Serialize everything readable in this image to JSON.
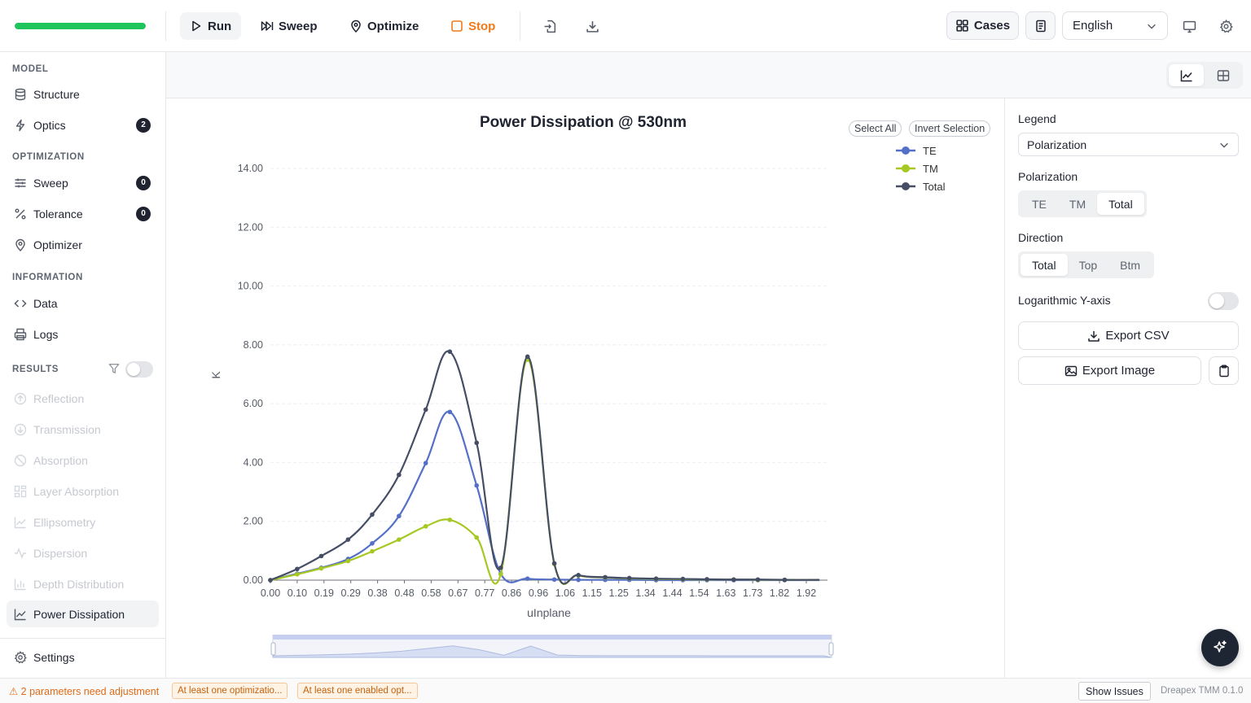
{
  "toolbar": {
    "progress": 1.0,
    "run_label": "Run",
    "sweep_label": "Sweep",
    "optimize_label": "Optimize",
    "stop_label": "Stop",
    "cases_label": "Cases",
    "language": "English"
  },
  "sidebar": {
    "model_title": "MODEL",
    "structure": "Structure",
    "optics": "Optics",
    "optics_count": "2",
    "optimization_title": "OPTIMIZATION",
    "sweep": "Sweep",
    "sweep_count": "0",
    "tolerance": "Tolerance",
    "tolerance_count": "0",
    "optimizer": "Optimizer",
    "information_title": "INFORMATION",
    "data": "Data",
    "logs": "Logs",
    "results_title": "RESULTS",
    "results": [
      "Reflection",
      "Transmission",
      "Absorption",
      "Layer Absorption",
      "Ellipsometry",
      "Dispersion",
      "Depth Distribution",
      "Power Dissipation"
    ],
    "settings": "Settings"
  },
  "chart": {
    "select_all": "Select All",
    "invert_selection": "Invert Selection"
  },
  "chart_data": {
    "type": "line",
    "title": "Power Dissipation @ 530nm",
    "xlabel": "uInplane",
    "ylabel": "K",
    "ylim": [
      0,
      14
    ],
    "yticks": [
      "0.00",
      "2.00",
      "4.00",
      "6.00",
      "8.00",
      "10.00",
      "12.00",
      "14.00"
    ],
    "xticks": [
      "0.00",
      "0.10",
      "0.19",
      "0.29",
      "0.38",
      "0.48",
      "0.58",
      "0.67",
      "0.77",
      "0.86",
      "0.96",
      "1.06",
      "1.15",
      "1.25",
      "1.34",
      "1.44",
      "1.54",
      "1.63",
      "1.73",
      "1.82",
      "1.92"
    ],
    "legend_position": "top-right",
    "grid": true,
    "series": [
      {
        "name": "TE",
        "color": "#5470c6",
        "x": [
          0.0,
          0.1,
          0.19,
          0.29,
          0.38,
          0.48,
          0.58,
          0.67,
          0.77,
          0.86,
          0.96,
          1.06,
          1.15,
          1.25,
          1.34,
          1.44,
          1.54,
          1.63,
          1.73,
          1.82,
          1.92,
          2.05
        ],
        "values": [
          0.0,
          0.22,
          0.42,
          0.72,
          1.25,
          2.18,
          3.98,
          5.72,
          3.22,
          0.22,
          0.05,
          0.02,
          0.01,
          0.01,
          0.01,
          0.0,
          0.0,
          0.0,
          0.0,
          0.0,
          0.0,
          0.0
        ]
      },
      {
        "name": "TM",
        "color": "#a6c822",
        "x": [
          0.0,
          0.1,
          0.19,
          0.29,
          0.38,
          0.48,
          0.58,
          0.67,
          0.77,
          0.86,
          0.96,
          1.06,
          1.15,
          1.25,
          1.34,
          1.44,
          1.54,
          1.63,
          1.73,
          1.82,
          1.92,
          2.05
        ],
        "values": [
          0.0,
          0.2,
          0.4,
          0.65,
          0.98,
          1.38,
          1.83,
          2.05,
          1.45,
          0.2,
          7.5,
          0.55,
          0.16,
          0.09,
          0.06,
          0.04,
          0.03,
          0.02,
          0.02,
          0.01,
          0.01,
          0.01
        ]
      },
      {
        "name": "Total",
        "color": "#464e66",
        "x": [
          0.0,
          0.1,
          0.19,
          0.29,
          0.38,
          0.48,
          0.58,
          0.67,
          0.77,
          0.86,
          0.96,
          1.06,
          1.15,
          1.25,
          1.34,
          1.44,
          1.54,
          1.63,
          1.73,
          1.82,
          1.92,
          2.05
        ],
        "values": [
          0.0,
          0.38,
          0.82,
          1.38,
          2.23,
          3.58,
          5.8,
          7.77,
          4.67,
          0.42,
          7.6,
          0.57,
          0.17,
          0.1,
          0.07,
          0.05,
          0.04,
          0.03,
          0.02,
          0.02,
          0.01,
          0.01
        ]
      }
    ]
  },
  "right_panel": {
    "legend_label": "Legend",
    "legend_value": "Polarization",
    "polarization_label": "Polarization",
    "polarization_options": [
      "TE",
      "TM",
      "Total"
    ],
    "direction_label": "Direction",
    "direction_options": [
      "Total",
      "Top",
      "Btm"
    ],
    "log_label": "Logarithmic Y-axis",
    "export_csv": "Export CSV",
    "export_image": "Export Image"
  },
  "status": {
    "warning": "⚠ 2 parameters need adjustment",
    "chip1": "At least one optimizatio...",
    "chip2": "At least one enabled opt...",
    "show_issues": "Show Issues",
    "version": "Dreapex TMM 0.1.0"
  }
}
